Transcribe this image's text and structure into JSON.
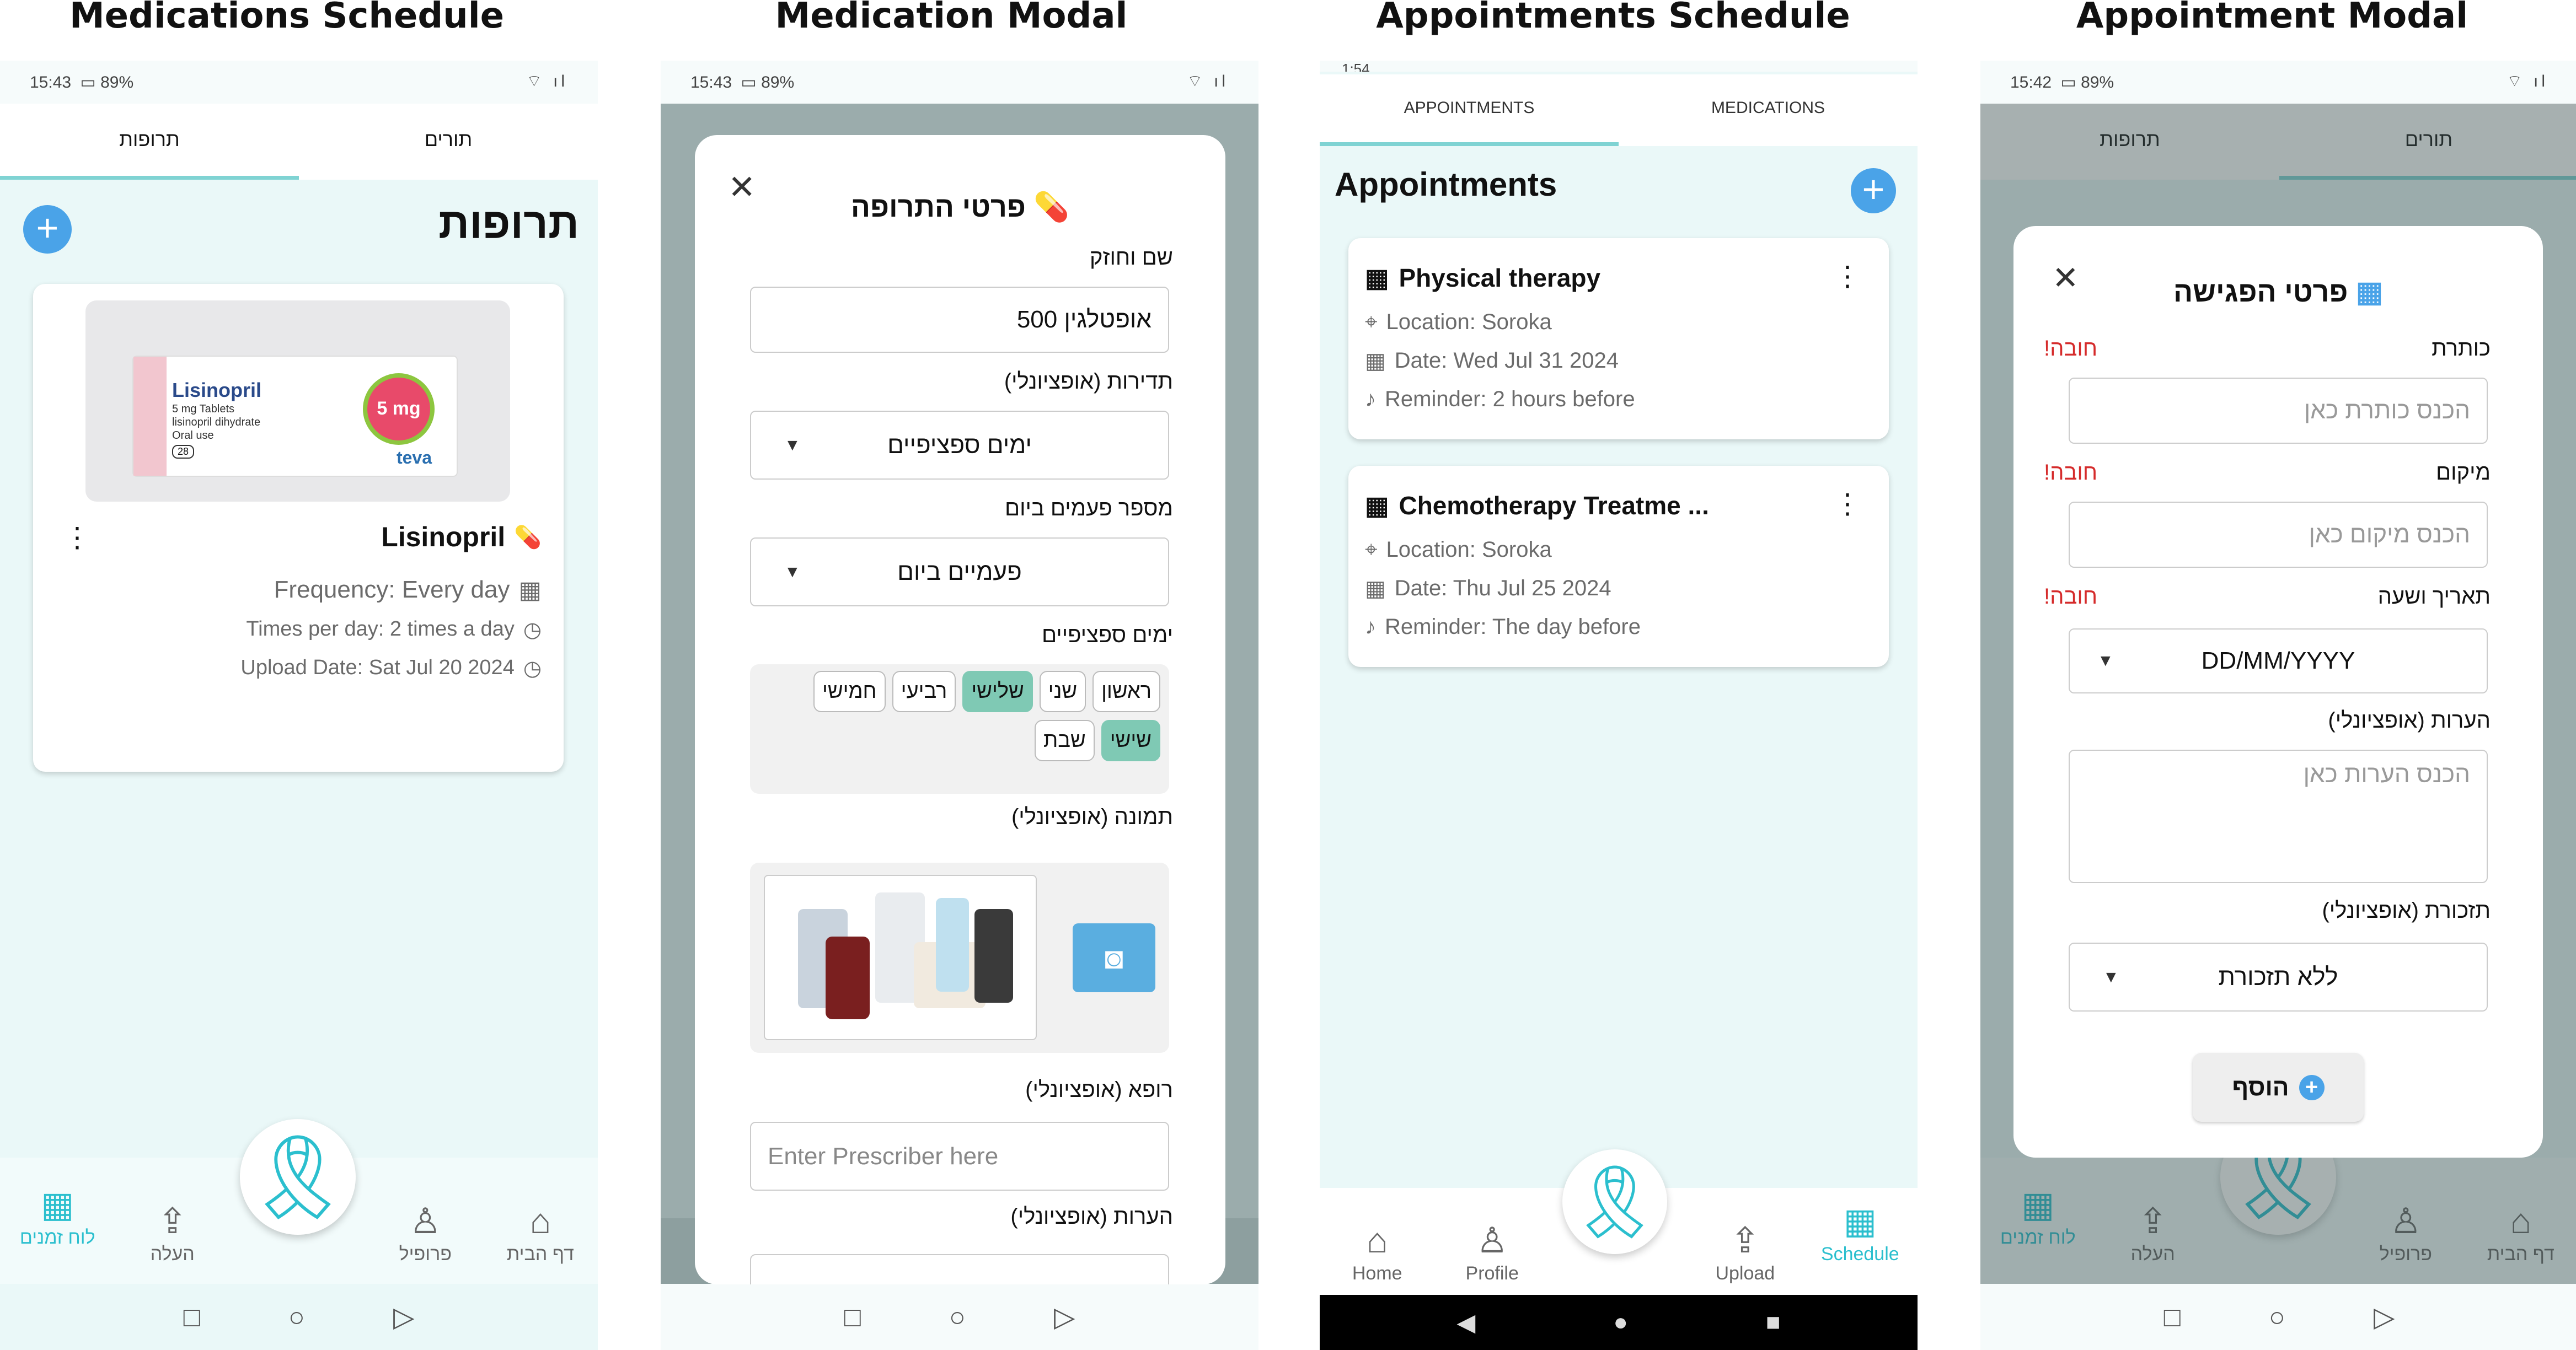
{
  "panels": [
    {
      "title": "Medications Schedule"
    },
    {
      "title": "Medication Modal"
    },
    {
      "title": "Appointments Schedule"
    },
    {
      "title": "Appointment Modal"
    }
  ],
  "status": {
    "time1": "15:43",
    "battery1": "89%",
    "time4": "15:42",
    "battery4": "89%",
    "time3": "1:54"
  },
  "he_tabs": {
    "medications": "תרופות",
    "appointments": "תורים"
  },
  "med_screen": {
    "heading": "תרופות",
    "card": {
      "name": "Lisinopril",
      "frequency": "Frequency: Every day",
      "times": "Times per day: 2 times a day",
      "upload": "Upload Date: Sat Jul 20 2024",
      "box_title": "Lisinopril",
      "box_line1": "5 mg Tablets",
      "box_line2": "lisinopril dihydrate",
      "box_line3": "Oral use",
      "box_dose": "5 mg",
      "box_brand": "teva",
      "box_count": "28"
    }
  },
  "he_nav": {
    "home": "דף הבית",
    "profile": "פרופיל",
    "upload": "העלה",
    "schedule": "לוח זמנים"
  },
  "med_modal": {
    "title": "פרטי התרופה",
    "name_label": "שם וחוזק",
    "name_value": "אופטלגין 500",
    "freq_label": "תדירות (אופציונלי)",
    "freq_value": "ימים ספציפיים",
    "times_label": "מספר פעמים ביום",
    "times_value": "פעמיים ביום",
    "days_label": "ימים ספציפיים",
    "days_row1": [
      {
        "d": "ראשון",
        "sel": false
      },
      {
        "d": "שני",
        "sel": false
      },
      {
        "d": "שלישי",
        "sel": true
      },
      {
        "d": "רביעי",
        "sel": false
      },
      {
        "d": "חמישי",
        "sel": false
      }
    ],
    "days_row2": [
      {
        "d": "שישי",
        "sel": true
      },
      {
        "d": "שבת",
        "sel": false
      }
    ],
    "image_label": "תמונה (אופציונלי)",
    "doctor_label": "רופא (אופציונלי)",
    "doctor_placeholder": "Enter Prescriber here",
    "notes_label": "הערות (אופציונלי)"
  },
  "appt_screen": {
    "tabs": [
      "APPOINTMENTS",
      "MEDICATIONS"
    ],
    "heading": "Appointments",
    "cards": [
      {
        "title": "Physical therapy",
        "location": "Location: Soroka",
        "date": "Date: Wed Jul 31 2024",
        "reminder": "Reminder: 2 hours before"
      },
      {
        "title": "Chemotherapy Treatme ...",
        "location": "Location: Soroka",
        "date": "Date: Thu Jul 25 2024",
        "reminder": "Reminder: The day before"
      }
    ],
    "nav": {
      "home": "Home",
      "profile": "Profile",
      "upload": "Upload",
      "schedule": "Schedule"
    }
  },
  "appt_modal": {
    "title": "פרטי הפגישה",
    "title_label": "כותרת",
    "title_placeholder": "הכנס כותרת כאן",
    "location_label": "מיקום",
    "location_placeholder": "הכנס מיקום כאן",
    "date_label": "תאריך ושעה",
    "date_value": "DD/MM/YYYY",
    "notes_label": "הערות (אופציונלי)",
    "notes_placeholder": "הכנס הערות כאן",
    "reminder_label": "תזכורת (אופציונלי)",
    "reminder_value": "ללא תזכורת",
    "add_button": "הוסף",
    "required": "חובה!"
  },
  "colors": {
    "accent": "#7fd3d3",
    "fab": "#4aa3e8",
    "ribbon": "#2bbfce",
    "selected_day": "#7fc9b4",
    "required": "#d52b2b"
  }
}
